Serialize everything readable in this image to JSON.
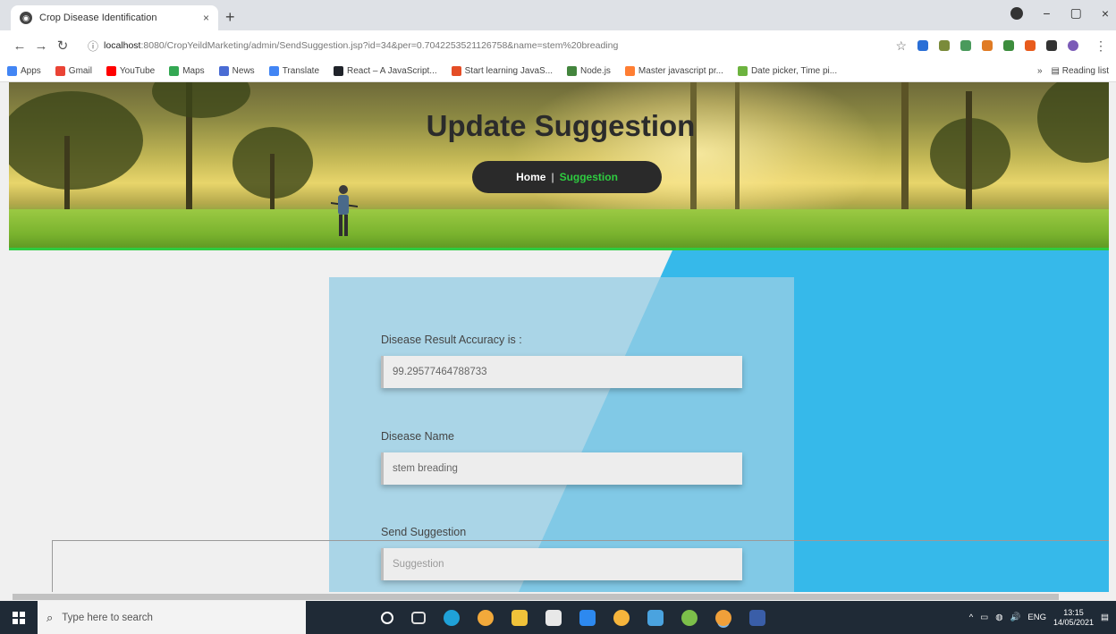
{
  "browser": {
    "tab_title": "Crop Disease Identification",
    "tab_close": "×",
    "new_tab": "+",
    "url_host": "localhost",
    "url_rest": ":8080/CropYeildMarketing/admin/SendSuggestion.jsp?id=34&per=0.7042253521126758&name=stem%20breading",
    "window_minimize": "−",
    "window_restore": "▢",
    "window_close": "×"
  },
  "bookmarks": [
    {
      "label": "Apps",
      "color": "#4285f4"
    },
    {
      "label": "Gmail",
      "color": "#ea4335"
    },
    {
      "label": "YouTube",
      "color": "#ff0000"
    },
    {
      "label": "Maps",
      "color": "#34a853"
    },
    {
      "label": "News",
      "color": "#4a6cd4"
    },
    {
      "label": "Translate",
      "color": "#4285f4"
    },
    {
      "label": "React – A JavaScript...",
      "color": "#20232a"
    },
    {
      "label": "Start learning JavaS...",
      "color": "#e44d26"
    },
    {
      "label": "Node.js",
      "color": "#43853d"
    },
    {
      "label": "Master javascript pr...",
      "color": "#ff7e33"
    },
    {
      "label": "Date picker, Time pi...",
      "color": "#6db33f"
    }
  ],
  "bookmarks_more": "»",
  "reading_list": "Reading list",
  "hero": {
    "title": "Update Suggestion",
    "breadcrumb_home": "Home",
    "breadcrumb_sep": "|",
    "breadcrumb_current": "Suggestion"
  },
  "form": {
    "accuracy_label": "Disease Result Accuracy is :",
    "accuracy_value": "99.29577464788733",
    "disease_label": "Disease Name",
    "disease_value": "stem breading",
    "suggestion_label": "Send Suggestion",
    "suggestion_placeholder": "Suggestion"
  },
  "taskbar": {
    "search_placeholder": "Type here to search",
    "tray_lang": "ENG",
    "time": "13:15",
    "date": "14/05/2021"
  },
  "colors": {
    "accent_green": "#2ecc40",
    "panel_blue": "#36b9ea"
  }
}
